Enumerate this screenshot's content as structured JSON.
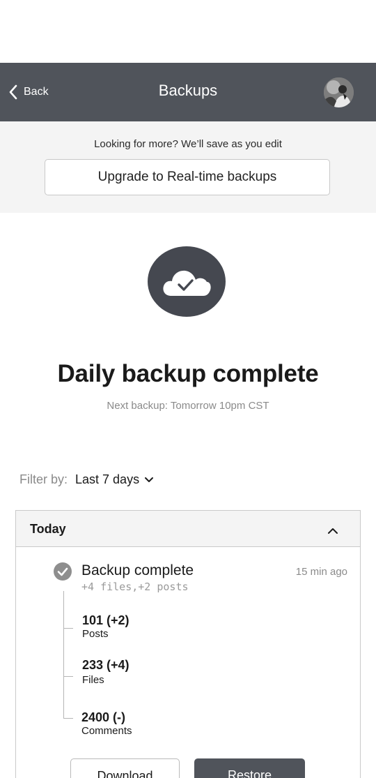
{
  "header": {
    "back_label": "Back",
    "title": "Backups"
  },
  "upsell": {
    "text": "Looking for more? We’ll save as you edit",
    "button_label": "Upgrade to Real-time backups"
  },
  "status": {
    "headline": "Daily backup complete",
    "next_backup": "Next backup:  Tomorrow 10pm CST"
  },
  "filter": {
    "label": "Filter by:",
    "selected": "Last 7 days"
  },
  "group": {
    "title": "Today",
    "entry": {
      "title": "Backup complete",
      "time": "15 min ago",
      "summary": "+4 files,+2 posts",
      "stats": [
        {
          "value": "101 (+2)",
          "label": "Posts"
        },
        {
          "value": "233 (+4)",
          "label": "Files"
        },
        {
          "value": "2400 (-)",
          "label": "Comments"
        }
      ]
    },
    "actions": {
      "download_label": "Download",
      "restore_label": "Restore"
    }
  },
  "icons": {
    "back": "chevron-left-icon",
    "avatar": "user-avatar",
    "status": "cloud-check-icon",
    "filter_caret": "chevron-down-icon",
    "collapse": "chevron-up-icon",
    "entry_status": "check-circle-icon"
  },
  "colors": {
    "header_bg": "#50545b",
    "upsell_bg": "#f4f4f4",
    "icon_circle": "#454850",
    "restore_bg": "#50545b",
    "muted_text": "#8a8a8a"
  }
}
